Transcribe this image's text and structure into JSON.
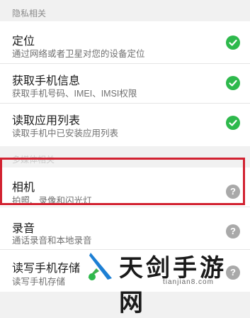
{
  "sections": {
    "privacy_header": "隐私相关",
    "multimedia_header": "多媒体相关"
  },
  "privacy_items": [
    {
      "title": "定位",
      "description": "通过网络或者卫星对您的设备定位",
      "status_icon": "check-icon"
    },
    {
      "title": "获取手机信息",
      "description": "获取手机号码、IMEI、IMSI权限",
      "status_icon": "check-icon"
    },
    {
      "title": "读取应用列表",
      "description": "读取手机中已安装应用列表",
      "status_icon": "check-icon"
    }
  ],
  "multimedia_items": [
    {
      "title": "相机",
      "description": "拍照、录像和闪光灯",
      "status_icon": "question-icon",
      "status_glyph": "?"
    },
    {
      "title": "录音",
      "description": "通话录音和本地录音",
      "status_icon": "question-icon",
      "status_glyph": "?"
    },
    {
      "title": "读写手机存储",
      "description": "读写手机存储",
      "status_icon": "question-icon",
      "status_glyph": "?"
    }
  ],
  "watermark": {
    "title": "天剑手游网",
    "url": "tianjian8.com"
  },
  "colors": {
    "ok": "#2eb94c",
    "unknown": "#a9a9a9",
    "highlight": "#d22231",
    "background": "#f1f1f1"
  }
}
